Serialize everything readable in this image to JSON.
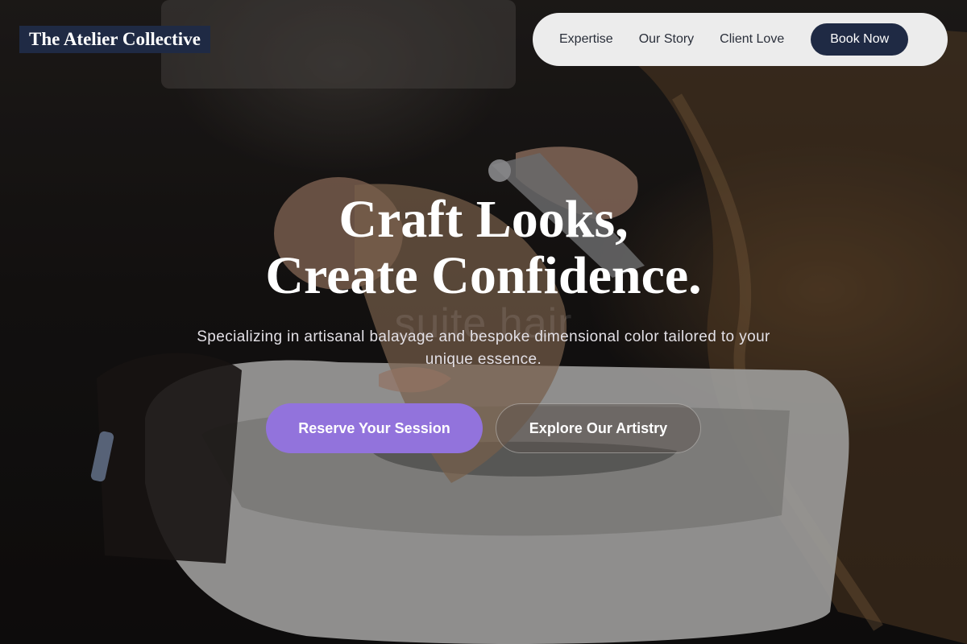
{
  "brand": {
    "name": "The Atelier Collective"
  },
  "nav": {
    "items": [
      {
        "label": "Expertise"
      },
      {
        "label": "Our Story"
      },
      {
        "label": "Client Love"
      }
    ],
    "cta_label": "Book Now"
  },
  "hero": {
    "title_line1": "Craft Looks,",
    "title_line2": "Create Confidence.",
    "subtitle_line1": "Specializing in artisanal balayage and bespoke dimensional color tailored to your",
    "subtitle_line2": "unique essence.",
    "watermark": "suite hair",
    "primary_cta": "Reserve Your Session",
    "secondary_cta": "Explore Our Artistry"
  },
  "colors": {
    "brand_navy": "#1f2a44",
    "accent_purple": "#9273dc",
    "nav_bg": "#ececec"
  }
}
